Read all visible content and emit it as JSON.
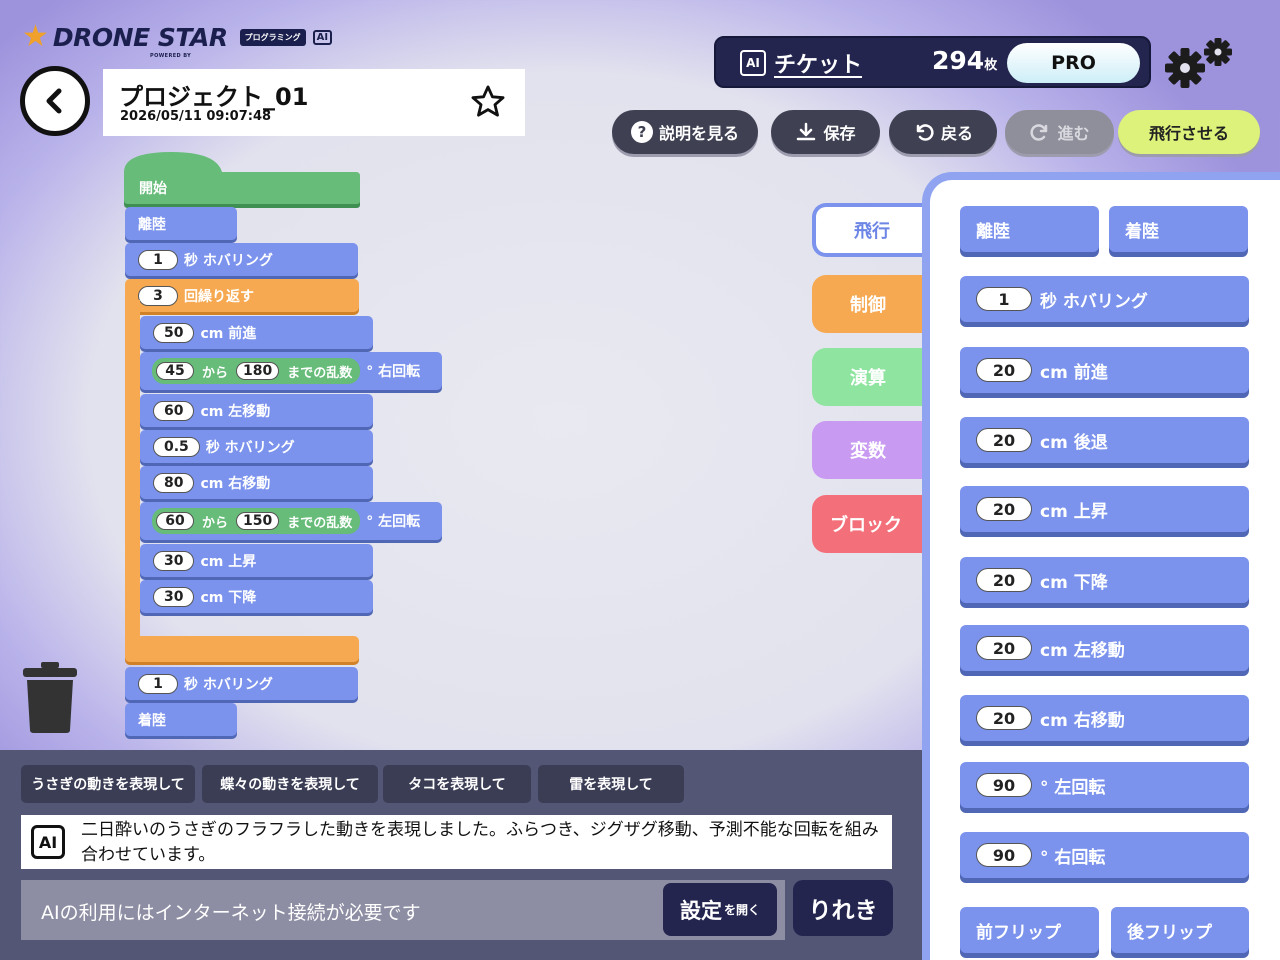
{
  "logo": {
    "name": "DRONE STAR",
    "badge": "プログラミング",
    "ai": "AI",
    "powered": "POWERED BY"
  },
  "project": {
    "title": "プロジェクト_01",
    "date": "2026/05/11 09:07:48"
  },
  "ticket": {
    "label": "チケット",
    "count": "294",
    "unit": "枚",
    "plan": "PRO"
  },
  "toolbar": {
    "help": "説明を見る",
    "save": "保存",
    "undo": "戻る",
    "redo": "進む",
    "fly": "飛行させる"
  },
  "program": {
    "start": "開始",
    "takeoff": "離陸",
    "hover1": {
      "value": "1",
      "label": "秒 ホバリング"
    },
    "repeat": {
      "value": "3",
      "label": "回繰り返す"
    },
    "forward": {
      "value": "50",
      "label": "cm 前進"
    },
    "rand1": {
      "from": "45",
      "from_label": "から",
      "to": "180",
      "to_label": "までの乱数",
      "suffix": "° 右回転"
    },
    "left": {
      "value": "60",
      "label": "cm 左移動"
    },
    "hover2": {
      "value": "0.5",
      "label": "秒 ホバリング"
    },
    "right": {
      "value": "80",
      "label": "cm 右移動"
    },
    "rand2": {
      "from": "60",
      "from_label": "から",
      "to": "150",
      "to_label": "までの乱数",
      "suffix": "° 左回転"
    },
    "up": {
      "value": "30",
      "label": "cm 上昇"
    },
    "down": {
      "value": "30",
      "label": "cm 下降"
    },
    "hover3": {
      "value": "1",
      "label": "秒 ホバリング"
    },
    "land": "着陸"
  },
  "categories": [
    "飛行",
    "制御",
    "演算",
    "変数",
    "ブロック"
  ],
  "category_colors": [
    "#7b93ed",
    "#f6a951",
    "#8fe4a0",
    "#c99af2",
    "#f3707a"
  ],
  "palette": {
    "takeoff": "離陸",
    "land": "着陸",
    "hover": {
      "value": "1",
      "label": "秒 ホバリング"
    },
    "forward": {
      "value": "20",
      "label": "cm 前進"
    },
    "back": {
      "value": "20",
      "label": "cm 後退"
    },
    "up": {
      "value": "20",
      "label": "cm 上昇"
    },
    "down": {
      "value": "20",
      "label": "cm 下降"
    },
    "left": {
      "value": "20",
      "label": "cm 左移動"
    },
    "right": {
      "value": "20",
      "label": "cm 右移動"
    },
    "rotl": {
      "value": "90",
      "label": "° 左回転"
    },
    "rotr": {
      "value": "90",
      "label": "° 右回転"
    },
    "flipf": "前フリップ",
    "flipb": "後フリップ"
  },
  "ai": {
    "suggestions": [
      "うさぎの動きを表現して",
      "蝶々の動きを表現して",
      "タコを表現して",
      "雷を表現して"
    ],
    "icon": "AI",
    "message": "二日酔いのうさぎのフラフラした動きを表現しました。ふらつき、ジグザグ移動、予測不能な回転を組み合わせています。",
    "placeholder": "AIの利用にはインターネット接続が必要です",
    "settings": "設定",
    "settings_small": "を開く",
    "voice": "りれき"
  }
}
